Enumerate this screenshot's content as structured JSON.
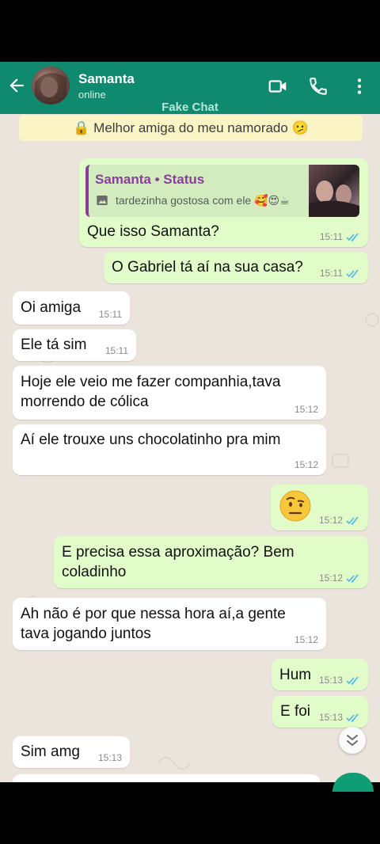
{
  "header": {
    "contact_name": "Samanta",
    "status": "online",
    "fake_label": "Fake Chat",
    "color": "#0f8a6e"
  },
  "banner": {
    "text": "🔒 Melhor amiga do meu namorado 🫤"
  },
  "messages": [
    {
      "dir": "out",
      "reply": {
        "title": "Samanta • Status",
        "text": "tardezinha gostosa com ele 🥰😍☕"
      },
      "text": "Que isso Samanta?",
      "time": "15:11",
      "read": true
    },
    {
      "dir": "out",
      "text": "O Gabriel tá aí na sua casa?",
      "time": "15:11",
      "read": true
    },
    {
      "dir": "in",
      "text": "Oi amiga",
      "time": "15:11"
    },
    {
      "dir": "in",
      "text": "Ele tá sim",
      "time": "15:11"
    },
    {
      "dir": "in",
      "text": "Hoje ele veio me fazer companhia,tava\nmorrendo de cólica",
      "time": "15:12"
    },
    {
      "dir": "in",
      "text": "Aí ele trouxe uns chocolatinho pra mim",
      "time": "15:12"
    },
    {
      "dir": "out",
      "text": "🤨",
      "time": "15:12",
      "read": true
    },
    {
      "dir": "out",
      "text": "E precisa essa aproximação? Bem\ncoladinho",
      "time": "15:12",
      "read": true
    },
    {
      "dir": "in",
      "text": "Ah não é por que nessa hora aí,a gente\ntava jogando juntos",
      "time": "15:12"
    },
    {
      "dir": "out",
      "text": "Hum",
      "time": "15:13",
      "read": true
    },
    {
      "dir": "out",
      "text": "E foi",
      "time": "15:13",
      "read": true
    },
    {
      "dir": "in",
      "text": "Sim amg",
      "time": "15:13"
    }
  ]
}
